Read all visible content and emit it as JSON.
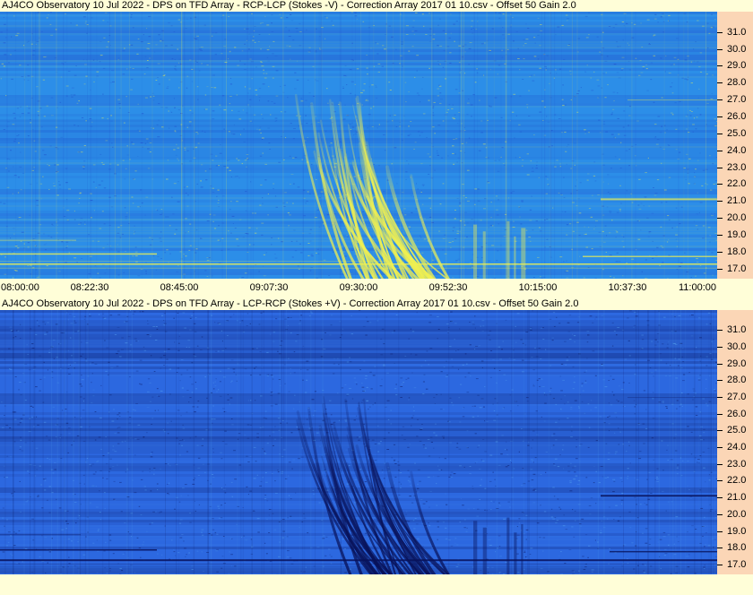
{
  "chart_data": [
    {
      "type": "heatmap",
      "title": "AJ4CO Observatory 10 Jul 2022  -  DPS on TFD Array  -  RCP-LCP (Stokes -V)  -  Correction Array 2017 01 10.csv  -  Offset 50  Gain 2.0",
      "x_ticks": [
        "08:00:00",
        "08:22:30",
        "08:45:00",
        "09:07:30",
        "09:30:00",
        "09:52:30",
        "10:15:00",
        "10:37:30",
        "11:00:00"
      ],
      "y_ticks": [
        "31.0",
        "30.0",
        "29.0",
        "28.0",
        "27.0",
        "26.0",
        "25.0",
        "24.0",
        "23.0",
        "22.0",
        "21.0",
        "20.0",
        "19.0",
        "18.0",
        "17.0"
      ],
      "y_range": [
        16.4,
        32.2
      ],
      "x_range": [
        "08:00:00",
        "11:00:00"
      ],
      "colormap": {
        "low": "#1e46c8",
        "mid": "#2c8ee8",
        "high": "#f0f050"
      },
      "polarity": "bright"
    },
    {
      "type": "heatmap",
      "title": "AJ4CO Observatory 10 Jul 2022  -  DPS on TFD Array  -  LCP-RCP (Stokes +V)  -  Correction Array 2017 01 10.csv  -  Offset 50  Gain 2.0",
      "y_ticks": [
        "31.0",
        "30.0",
        "29.0",
        "28.0",
        "27.0",
        "26.0",
        "25.0",
        "24.0",
        "23.0",
        "22.0",
        "21.0",
        "20.0",
        "19.0",
        "18.0",
        "17.0"
      ],
      "y_range": [
        16.4,
        32.2
      ],
      "x_range": [
        "08:00:00",
        "11:00:00"
      ],
      "colormap": {
        "low": "#08125a",
        "mid": "#2c68e0",
        "high": "#5aa8f0"
      },
      "polarity": "dark"
    }
  ]
}
